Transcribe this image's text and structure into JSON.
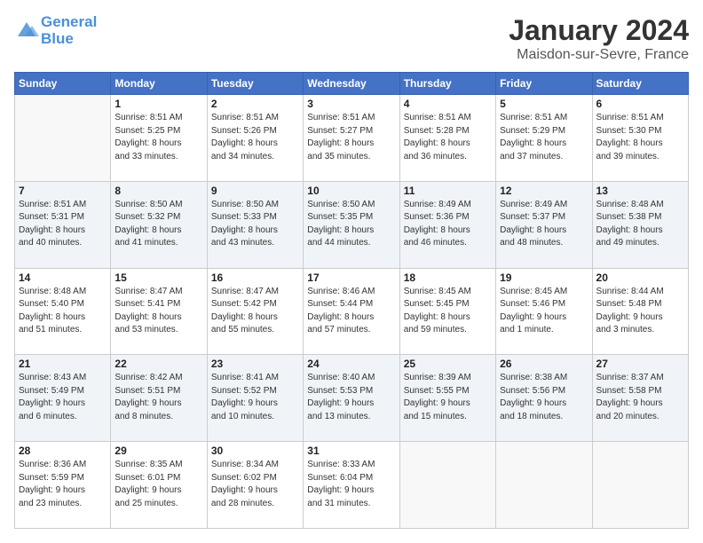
{
  "header": {
    "logo_line1": "General",
    "logo_line2": "Blue",
    "title": "January 2024",
    "subtitle": "Maisdon-sur-Sevre, France"
  },
  "columns": [
    "Sunday",
    "Monday",
    "Tuesday",
    "Wednesday",
    "Thursday",
    "Friday",
    "Saturday"
  ],
  "weeks": [
    {
      "shade": "white",
      "days": [
        {
          "num": "",
          "info": ""
        },
        {
          "num": "1",
          "info": "Sunrise: 8:51 AM\nSunset: 5:25 PM\nDaylight: 8 hours\nand 33 minutes."
        },
        {
          "num": "2",
          "info": "Sunrise: 8:51 AM\nSunset: 5:26 PM\nDaylight: 8 hours\nand 34 minutes."
        },
        {
          "num": "3",
          "info": "Sunrise: 8:51 AM\nSunset: 5:27 PM\nDaylight: 8 hours\nand 35 minutes."
        },
        {
          "num": "4",
          "info": "Sunrise: 8:51 AM\nSunset: 5:28 PM\nDaylight: 8 hours\nand 36 minutes."
        },
        {
          "num": "5",
          "info": "Sunrise: 8:51 AM\nSunset: 5:29 PM\nDaylight: 8 hours\nand 37 minutes."
        },
        {
          "num": "6",
          "info": "Sunrise: 8:51 AM\nSunset: 5:30 PM\nDaylight: 8 hours\nand 39 minutes."
        }
      ]
    },
    {
      "shade": "shade",
      "days": [
        {
          "num": "7",
          "info": "Sunrise: 8:51 AM\nSunset: 5:31 PM\nDaylight: 8 hours\nand 40 minutes."
        },
        {
          "num": "8",
          "info": "Sunrise: 8:50 AM\nSunset: 5:32 PM\nDaylight: 8 hours\nand 41 minutes."
        },
        {
          "num": "9",
          "info": "Sunrise: 8:50 AM\nSunset: 5:33 PM\nDaylight: 8 hours\nand 43 minutes."
        },
        {
          "num": "10",
          "info": "Sunrise: 8:50 AM\nSunset: 5:35 PM\nDaylight: 8 hours\nand 44 minutes."
        },
        {
          "num": "11",
          "info": "Sunrise: 8:49 AM\nSunset: 5:36 PM\nDaylight: 8 hours\nand 46 minutes."
        },
        {
          "num": "12",
          "info": "Sunrise: 8:49 AM\nSunset: 5:37 PM\nDaylight: 8 hours\nand 48 minutes."
        },
        {
          "num": "13",
          "info": "Sunrise: 8:48 AM\nSunset: 5:38 PM\nDaylight: 8 hours\nand 49 minutes."
        }
      ]
    },
    {
      "shade": "white",
      "days": [
        {
          "num": "14",
          "info": "Sunrise: 8:48 AM\nSunset: 5:40 PM\nDaylight: 8 hours\nand 51 minutes."
        },
        {
          "num": "15",
          "info": "Sunrise: 8:47 AM\nSunset: 5:41 PM\nDaylight: 8 hours\nand 53 minutes."
        },
        {
          "num": "16",
          "info": "Sunrise: 8:47 AM\nSunset: 5:42 PM\nDaylight: 8 hours\nand 55 minutes."
        },
        {
          "num": "17",
          "info": "Sunrise: 8:46 AM\nSunset: 5:44 PM\nDaylight: 8 hours\nand 57 minutes."
        },
        {
          "num": "18",
          "info": "Sunrise: 8:45 AM\nSunset: 5:45 PM\nDaylight: 8 hours\nand 59 minutes."
        },
        {
          "num": "19",
          "info": "Sunrise: 8:45 AM\nSunset: 5:46 PM\nDaylight: 9 hours\nand 1 minute."
        },
        {
          "num": "20",
          "info": "Sunrise: 8:44 AM\nSunset: 5:48 PM\nDaylight: 9 hours\nand 3 minutes."
        }
      ]
    },
    {
      "shade": "shade",
      "days": [
        {
          "num": "21",
          "info": "Sunrise: 8:43 AM\nSunset: 5:49 PM\nDaylight: 9 hours\nand 6 minutes."
        },
        {
          "num": "22",
          "info": "Sunrise: 8:42 AM\nSunset: 5:51 PM\nDaylight: 9 hours\nand 8 minutes."
        },
        {
          "num": "23",
          "info": "Sunrise: 8:41 AM\nSunset: 5:52 PM\nDaylight: 9 hours\nand 10 minutes."
        },
        {
          "num": "24",
          "info": "Sunrise: 8:40 AM\nSunset: 5:53 PM\nDaylight: 9 hours\nand 13 minutes."
        },
        {
          "num": "25",
          "info": "Sunrise: 8:39 AM\nSunset: 5:55 PM\nDaylight: 9 hours\nand 15 minutes."
        },
        {
          "num": "26",
          "info": "Sunrise: 8:38 AM\nSunset: 5:56 PM\nDaylight: 9 hours\nand 18 minutes."
        },
        {
          "num": "27",
          "info": "Sunrise: 8:37 AM\nSunset: 5:58 PM\nDaylight: 9 hours\nand 20 minutes."
        }
      ]
    },
    {
      "shade": "white",
      "days": [
        {
          "num": "28",
          "info": "Sunrise: 8:36 AM\nSunset: 5:59 PM\nDaylight: 9 hours\nand 23 minutes."
        },
        {
          "num": "29",
          "info": "Sunrise: 8:35 AM\nSunset: 6:01 PM\nDaylight: 9 hours\nand 25 minutes."
        },
        {
          "num": "30",
          "info": "Sunrise: 8:34 AM\nSunset: 6:02 PM\nDaylight: 9 hours\nand 28 minutes."
        },
        {
          "num": "31",
          "info": "Sunrise: 8:33 AM\nSunset: 6:04 PM\nDaylight: 9 hours\nand 31 minutes."
        },
        {
          "num": "",
          "info": ""
        },
        {
          "num": "",
          "info": ""
        },
        {
          "num": "",
          "info": ""
        }
      ]
    }
  ]
}
